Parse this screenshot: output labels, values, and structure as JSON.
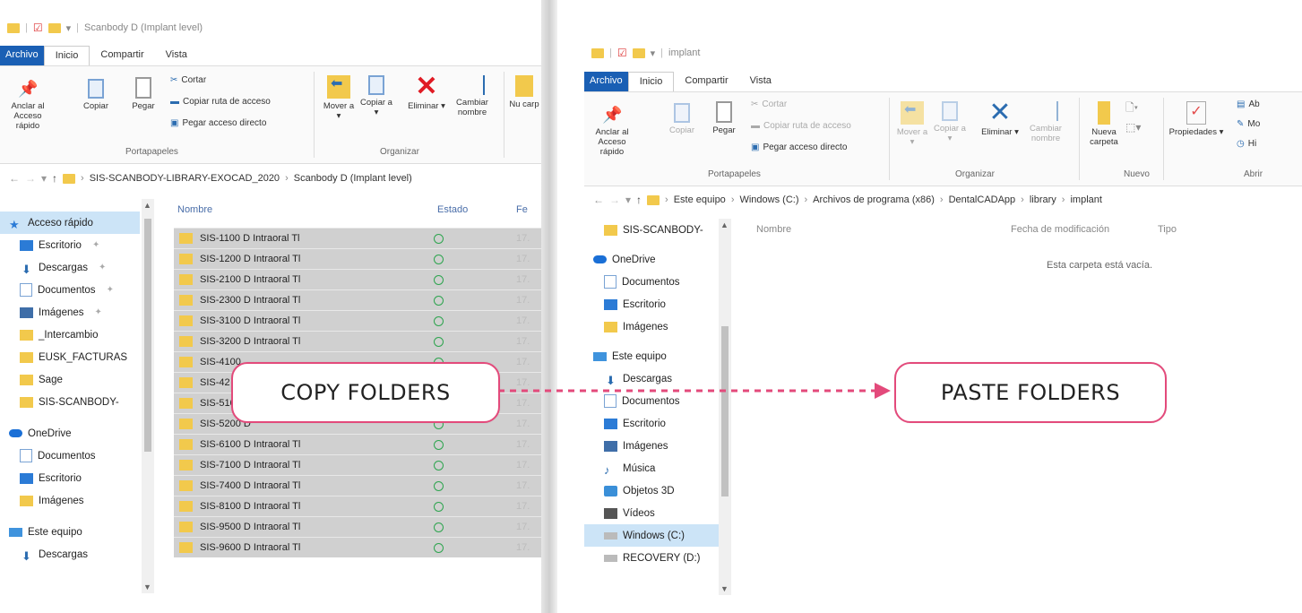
{
  "left_window": {
    "title": "Scanbody D (Implant level)",
    "tabs": [
      {
        "label": "Archivo"
      },
      {
        "label": "Inicio"
      },
      {
        "label": "Compartir"
      },
      {
        "label": "Vista"
      }
    ],
    "ribbon": {
      "pin_label": "Anclar al Acceso rápido",
      "copy_label": "Copiar",
      "paste_label": "Pegar",
      "cut_label": "Cortar",
      "copy_path_label": "Copiar ruta de acceso",
      "paste_shortcut_label": "Pegar acceso directo",
      "move_label": "Mover a ▾",
      "copy_to_label": "Copiar a ▾",
      "delete_label": "Eliminar ▾",
      "rename_label": "Cambiar nombre",
      "new_label": "Nu carp",
      "group_clipboard": "Portapapeles",
      "group_organize": "Organizar"
    },
    "address": {
      "segments": [
        "SIS-SCANBODY-LIBRARY-EXOCAD_2020",
        "Scanbody D (Implant level)"
      ]
    },
    "nav": [
      {
        "label": "Acceso rápido",
        "icon": "star-icon"
      },
      {
        "label": "Escritorio",
        "icon": "desktop-icon"
      },
      {
        "label": "Descargas",
        "icon": "download-icon"
      },
      {
        "label": "Documentos",
        "icon": "documents-icon"
      },
      {
        "label": "Imágenes",
        "icon": "pictures-icon"
      },
      {
        "label": "_Intercambio",
        "icon": "folder-icon"
      },
      {
        "label": "EUSK_FACTURAS",
        "icon": "folder-icon"
      },
      {
        "label": "Sage",
        "icon": "folder-icon"
      },
      {
        "label": "SIS-SCANBODY-",
        "icon": "folder-icon"
      },
      {
        "label": "OneDrive",
        "icon": "cloud-icon"
      },
      {
        "label": "Documentos",
        "icon": "documents-icon"
      },
      {
        "label": "Escritorio",
        "icon": "desktop-icon"
      },
      {
        "label": "Imágenes",
        "icon": "folder-icon"
      },
      {
        "label": "Este equipo",
        "icon": "pc-icon"
      },
      {
        "label": "Descargas",
        "icon": "download-icon"
      }
    ],
    "columns": {
      "name": "Nombre",
      "status": "Estado",
      "date": "Fe"
    },
    "files": [
      {
        "name": "SIS-1100 D Intraoral Tl",
        "date": "17."
      },
      {
        "name": "SIS-1200 D Intraoral Tl",
        "date": "17."
      },
      {
        "name": "SIS-2100 D Intraoral Tl",
        "date": "17."
      },
      {
        "name": "SIS-2300 D Intraoral Tl",
        "date": "17."
      },
      {
        "name": "SIS-3100 D Intraoral Tl",
        "date": "17."
      },
      {
        "name": "SIS-3200 D Intraoral Tl",
        "date": "17."
      },
      {
        "name": "SIS-4100",
        "date": "17."
      },
      {
        "name": "SIS-42",
        "date": "17."
      },
      {
        "name": "SIS-510",
        "date": "17."
      },
      {
        "name": "SIS-5200 D",
        "date": "17."
      },
      {
        "name": "SIS-6100 D Intraoral Tl",
        "date": "17."
      },
      {
        "name": "SIS-7100 D Intraoral Tl",
        "date": "17."
      },
      {
        "name": "SIS-7400 D Intraoral Tl",
        "date": "17."
      },
      {
        "name": "SIS-8100 D Intraoral Tl",
        "date": "17."
      },
      {
        "name": "SIS-9500 D Intraoral Tl",
        "date": "17."
      },
      {
        "name": "SIS-9600 D Intraoral Tl",
        "date": "17."
      }
    ]
  },
  "right_window": {
    "title": "implant",
    "tabs": [
      {
        "label": "Archivo"
      },
      {
        "label": "Inicio"
      },
      {
        "label": "Compartir"
      },
      {
        "label": "Vista"
      }
    ],
    "ribbon": {
      "pin_label": "Anclar al Acceso rápido",
      "copy_label": "Copiar",
      "paste_label": "Pegar",
      "cut_label": "Cortar",
      "copy_path_label": "Copiar ruta de acceso",
      "paste_shortcut_label": "Pegar acceso directo",
      "move_label": "Mover a ▾",
      "copy_to_label": "Copiar a ▾",
      "delete_label": "Eliminar ▾",
      "rename_label": "Cambiar nombre",
      "new_folder_label": "Nueva carpeta",
      "properties_label": "Propiedades ▾",
      "open_label_1": "Ab",
      "open_label_2": "Mo",
      "open_label_3": "Hi",
      "group_clipboard": "Portapapeles",
      "group_organize": "Organizar",
      "group_new": "Nuevo",
      "group_open": "Abrir"
    },
    "address": {
      "segments": [
        "Este equipo",
        "Windows (C:)",
        "Archivos de programa (x86)",
        "DentalCADApp",
        "library",
        "implant"
      ]
    },
    "nav": [
      {
        "label": "SIS-SCANBODY-",
        "icon": "folder-icon"
      },
      {
        "label": "OneDrive",
        "icon": "cloud-icon"
      },
      {
        "label": "Documentos",
        "icon": "documents-icon"
      },
      {
        "label": "Escritorio",
        "icon": "desktop-icon"
      },
      {
        "label": "Imágenes",
        "icon": "folder-icon"
      },
      {
        "label": "Este equipo",
        "icon": "pc-icon"
      },
      {
        "label": "Descargas",
        "icon": "download-icon"
      },
      {
        "label": "Documentos",
        "icon": "documents-icon"
      },
      {
        "label": "Escritorio",
        "icon": "desktop-icon"
      },
      {
        "label": "Imágenes",
        "icon": "pictures-icon"
      },
      {
        "label": "Música",
        "icon": "music-icon"
      },
      {
        "label": "Objetos 3D",
        "icon": "objects-3d-icon"
      },
      {
        "label": "Vídeos",
        "icon": "videos-icon"
      },
      {
        "label": "Windows (C:)",
        "icon": "drive-icon"
      },
      {
        "label": "RECOVERY (D:)",
        "icon": "drive-icon"
      }
    ],
    "columns": {
      "name": "Nombre",
      "date": "Fecha de modificación",
      "type": "Tipo"
    },
    "empty_text": "Esta carpeta está vacía."
  },
  "callouts": {
    "copy": "COPY FOLDERS",
    "paste": "PASTE FOLDERS"
  },
  "colors": {
    "accent": "#e34a7b",
    "file_tab": "#1a5fb4",
    "selection": "#d0d0d0"
  }
}
